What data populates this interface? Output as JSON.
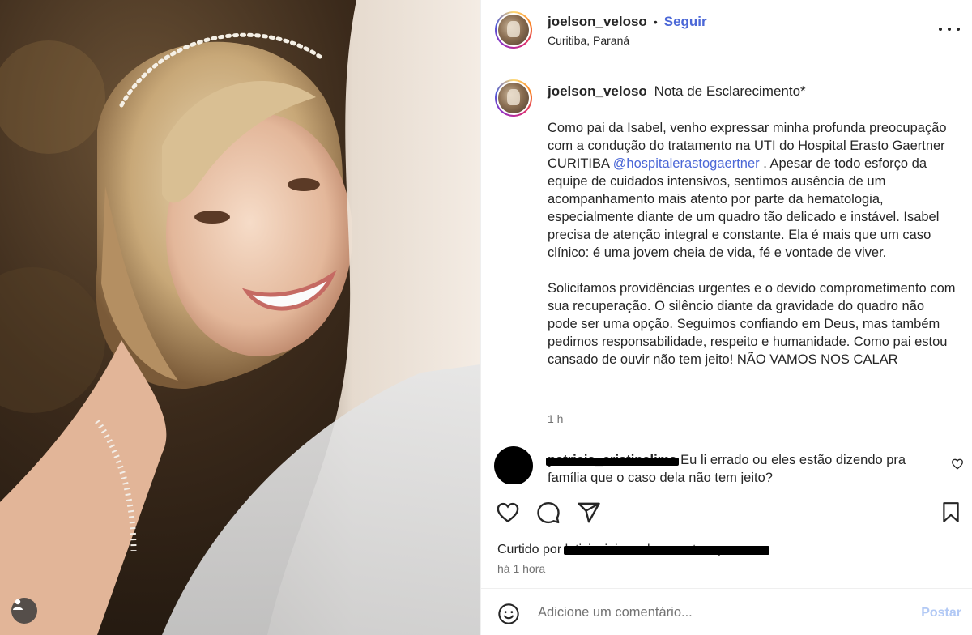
{
  "post": {
    "username": "joelson_veloso",
    "follow_label": "Seguir",
    "separator": "•",
    "location": "Curitiba, Paraná"
  },
  "caption": {
    "title": "Nota de Esclarecimento*",
    "p1_part1": "Como pai da Isabel, venho expressar minha profunda preocupação com a condução do tratamento na UTI do Hospital Erasto Gaertner CURITIBA ",
    "mention": "@hospitalerastogaertner",
    "p1_part2": " . Apesar de todo esforço da equipe de cuidados intensivos, sentimos ausência de um acompanhamento mais atento por parte da hematologia, especialmente diante de um quadro tão delicado e instável. Isabel precisa de atenção integral e constante. Ela é mais que um caso clínico: é uma jovem cheia de vida, fé e vontade de viver.",
    "p2": "Solicitamos providências urgentes e o devido comprometimento com sua recuperação. O silêncio diante da gravidade do quadro não pode ser uma opção. Seguimos confiando em Deus, mas também pedimos responsabilidade, respeito e humanidade. Como pai estou cansado de ouvir não tem jeito! NÃO VAMOS NOS CALAR",
    "time": "1 h"
  },
  "comment": {
    "username": "patricia_cristinalima",
    "text": "Eu li errado ou eles estão dizendo pra família que o caso dela não tem jeito?"
  },
  "likes": {
    "prefix": "Curtido por",
    "liked_by": "leticiavieiramalco e outras pessoas",
    "posted": "há 1 hora"
  },
  "add_comment": {
    "placeholder": "Adicione um comentário...",
    "post_label": "Postar"
  },
  "icons": {
    "more": "more-options-icon",
    "like": "heart-icon",
    "comment": "comment-icon",
    "share": "share-icon",
    "save": "bookmark-icon",
    "emoji": "emoji-icon",
    "tagged": "person-tag-icon"
  },
  "colors": {
    "link": "#4c68d7",
    "post_button_disabled": "#b2c9f5",
    "muted": "#737373"
  }
}
